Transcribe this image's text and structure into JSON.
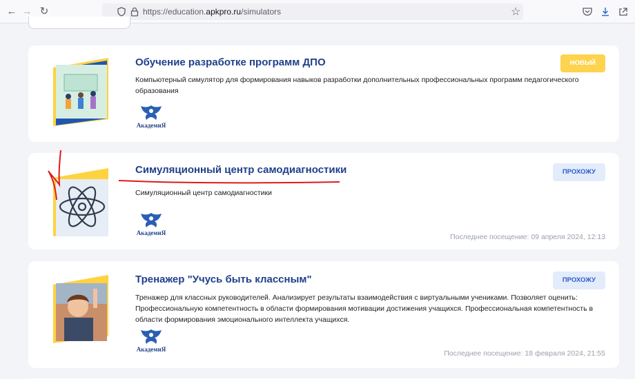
{
  "browser": {
    "url_prefix": "https://education.",
    "url_domain": "apkpro.ru",
    "url_path": "/simulators"
  },
  "cards": [
    {
      "title": "Обучение разработке программ ДПО",
      "description": "Компьютерный симулятор для формирования навыков разработки дополнительных профессиональных программ педагогического образования",
      "badge": "новый",
      "logo_text": "АкадемиЯ",
      "last_visit": ""
    },
    {
      "title": "Симуляционный центр самодиагностики",
      "description": "Симуляционный центр самодиагностики",
      "badge": "прохожу",
      "logo_text": "АкадемиЯ",
      "last_visit": "Последнее посещение: 09 апреля 2024, 12:13"
    },
    {
      "title": "Тренажер \"Учусь быть классным\"",
      "description": "Тренажер для классных руководителей.  Анализирует результаты взаимодействия с виртуальными учениками.  Позволяет оценить: Профессиональную компетентность в области формирования мотивации достижения учащихся.  Профессиональная компетентность в области формирования эмоционального интеллекта учащихся.",
      "badge": "прохожу",
      "logo_text": "АкадемиЯ",
      "last_visit": "Последнее посещение: 18 февраля 2024, 21:55"
    }
  ],
  "colors": {
    "title": "#1f3f8a",
    "badge_new_bg": "#fdd34f",
    "badge_progress_bg": "#e3ecfb",
    "annotation": "#e01818"
  }
}
